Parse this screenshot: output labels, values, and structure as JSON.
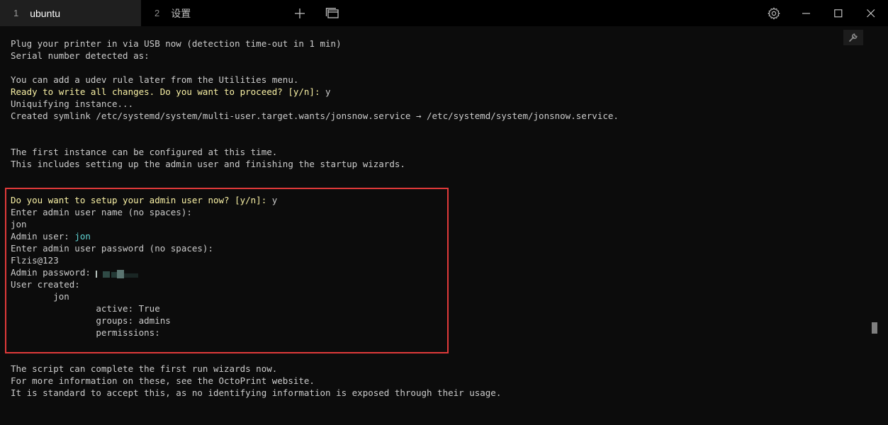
{
  "tabs": [
    {
      "number": "1",
      "label": "ubuntu"
    },
    {
      "number": "2",
      "label": "设置"
    }
  ],
  "titlebar": {
    "new_tab_icon": "plus-icon",
    "tab_overview_icon": "tabs-icon",
    "settings_icon": "gear-icon",
    "minimize_icon": "minimize-icon",
    "maximize_icon": "maximize-icon",
    "close_icon": "close-icon"
  },
  "terminal": {
    "wrench_icon": "wrench-icon",
    "colors": {
      "background": "#0c0c0c",
      "text": "#cccccc",
      "prompt": "#f9f1a5",
      "value": "#61d6d6",
      "highlight_box": "#e03a3a"
    },
    "lines": [
      "Plug your printer in via USB now (detection time-out in 1 min)",
      "Serial number detected as:",
      "",
      "You can add a udev rule later from the Utilities menu.",
      "Ready to write all changes. Do you want to proceed? [y/n]:",
      " y",
      "Uniquifying instance...",
      "Created symlink /etc/systemd/system/multi-user.target.wants/jonsnow.service → /etc/systemd/system/jonsnow.service.",
      "",
      "",
      "The first instance can be configured at this time.",
      "This includes setting up the admin user and finishing the startup wizards.",
      "",
      "",
      "Do you want to setup your admin user now? [y/n]:",
      " y",
      "Enter admin user name (no spaces):",
      "jon",
      "Admin user: ",
      "jon",
      "Enter admin user password (no spaces):",
      "Flzis@123",
      "Admin password: ",
      "User created:",
      "        jon",
      "                active: True",
      "                groups: admins",
      "                permissions:",
      "",
      "The script can complete the first run wizards now.",
      "For more information on these, see the OctoPrint website.",
      "It is standard to accept this, as no identifying information is exposed through their usage."
    ]
  }
}
